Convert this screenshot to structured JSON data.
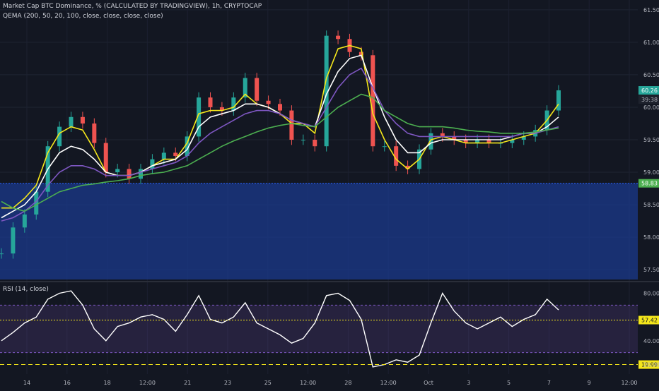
{
  "header": {
    "title": "Market Cap BTC Dominance, % (CALCULATED BY TRADINGVIEW), 1h, CRYPTOCAP",
    "indicator": "QEMA (200, 50, 20, 100, close, close, close, close)"
  },
  "rsi_header": "RSI (14, close)",
  "chart_data": [
    {
      "type": "line",
      "title": "Market Cap BTC Dominance, % (CALCULATED BY TRADINGVIEW), 1h, CRYPTOCAP",
      "ylim": [
        57.35,
        61.65
      ],
      "y_ticks": [
        "57.50",
        "58.00",
        "58.50",
        "59.00",
        "59.50",
        "60.00",
        "60.50",
        "61.00",
        "61.50"
      ],
      "x_ticks": [
        "14",
        "16",
        "18",
        "12:00",
        "21",
        "23",
        "25",
        "12:00",
        "28",
        "12:00",
        "Oct",
        "3",
        "5",
        "7",
        "9",
        "12:00"
      ],
      "x": [
        "13",
        "13.5",
        "14",
        "14.5",
        "15",
        "15.5",
        "16",
        "16.5",
        "17",
        "17.5",
        "18",
        "18.5",
        "19",
        "19.5",
        "20",
        "20.5",
        "21",
        "21.5",
        "22",
        "22.5",
        "23",
        "23.5",
        "24",
        "24.5",
        "25",
        "25.5",
        "26",
        "26.5",
        "27",
        "27.5",
        "28",
        "28.5",
        "29",
        "29.5",
        "30",
        "30.5",
        "Oct",
        "1.5",
        "2",
        "2.5",
        "3",
        "3.5",
        "4",
        "4.5",
        "5",
        "5.5",
        "6",
        "6.5",
        "7"
      ],
      "price": [
        57.75,
        58.15,
        58.35,
        58.7,
        59.4,
        59.7,
        59.85,
        59.75,
        59.45,
        59.0,
        59.05,
        58.9,
        59.05,
        59.2,
        59.3,
        59.25,
        59.55,
        60.15,
        60.0,
        59.95,
        60.15,
        60.45,
        60.1,
        60.05,
        59.95,
        59.5,
        59.5,
        59.4,
        61.1,
        61.05,
        60.85,
        60.8,
        59.4,
        59.4,
        59.1,
        59.05,
        59.35,
        59.6,
        59.55,
        59.5,
        59.45,
        59.5,
        59.45,
        59.45,
        59.5,
        59.55,
        59.65,
        59.95,
        60.26
      ],
      "series": [
        {
          "name": "QEMA 20",
          "color": "#f5e71b",
          "values": [
            58.45,
            58.45,
            58.6,
            58.8,
            59.3,
            59.6,
            59.7,
            59.65,
            59.35,
            59.0,
            58.95,
            58.95,
            59.0,
            59.1,
            59.2,
            59.2,
            59.45,
            59.9,
            59.95,
            59.95,
            60.0,
            60.2,
            60.05,
            60.0,
            59.9,
            59.75,
            59.75,
            59.6,
            60.45,
            60.9,
            60.95,
            60.9,
            59.9,
            59.5,
            59.2,
            59.05,
            59.2,
            59.5,
            59.55,
            59.5,
            59.45,
            59.45,
            59.45,
            59.45,
            59.5,
            59.55,
            59.6,
            59.8,
            60.05
          ]
        },
        {
          "name": "QEMA 50",
          "color": "#ffffff",
          "values": [
            58.3,
            58.4,
            58.5,
            58.7,
            59.05,
            59.3,
            59.4,
            59.35,
            59.2,
            59.0,
            58.95,
            58.95,
            59.0,
            59.1,
            59.15,
            59.2,
            59.35,
            59.7,
            59.85,
            59.9,
            59.95,
            60.05,
            60.05,
            60.0,
            59.9,
            59.8,
            59.75,
            59.7,
            60.2,
            60.55,
            60.75,
            60.8,
            60.3,
            59.85,
            59.5,
            59.3,
            59.3,
            59.45,
            59.5,
            59.5,
            59.5,
            59.5,
            59.5,
            59.5,
            59.55,
            59.6,
            59.6,
            59.7,
            59.85
          ]
        },
        {
          "name": "QEMA 100",
          "color": "#7e57c2",
          "values": [
            58.25,
            58.3,
            58.4,
            58.55,
            58.8,
            59.0,
            59.1,
            59.1,
            59.05,
            58.95,
            58.95,
            58.95,
            59.0,
            59.05,
            59.1,
            59.15,
            59.25,
            59.45,
            59.6,
            59.7,
            59.8,
            59.9,
            59.95,
            59.95,
            59.9,
            59.8,
            59.75,
            59.7,
            60.0,
            60.3,
            60.5,
            60.6,
            60.3,
            59.95,
            59.75,
            59.6,
            59.55,
            59.55,
            59.55,
            59.55,
            59.55,
            59.55,
            59.55,
            59.55,
            59.55,
            59.6,
            59.6,
            59.65,
            59.7
          ]
        },
        {
          "name": "QEMA 200",
          "color": "#4caf50",
          "values": [
            58.55,
            58.45,
            58.4,
            58.5,
            58.6,
            58.7,
            58.75,
            58.8,
            58.82,
            58.85,
            58.87,
            58.9,
            58.95,
            58.98,
            59.0,
            59.05,
            59.1,
            59.2,
            59.3,
            59.4,
            59.48,
            59.55,
            59.62,
            59.68,
            59.72,
            59.75,
            59.72,
            59.7,
            59.85,
            60.0,
            60.1,
            60.2,
            60.15,
            59.95,
            59.85,
            59.75,
            59.7,
            59.7,
            59.7,
            59.68,
            59.65,
            59.63,
            59.62,
            59.6,
            59.6,
            59.6,
            59.62,
            59.65,
            59.68
          ]
        }
      ],
      "last_price": "60.26",
      "countdown": "39:38",
      "level_label": "58.83",
      "level_value": 58.83
    },
    {
      "type": "line",
      "title": "RSI (14, close)",
      "ylim": [
        12,
        88
      ],
      "y_ticks": [
        "20.00",
        "40.00",
        "80.00"
      ],
      "band": [
        30,
        70
      ],
      "series": [
        {
          "name": "RSI",
          "color": "#ffffff",
          "values": [
            40,
            47,
            55,
            60,
            75,
            80,
            82,
            70,
            50,
            40,
            52,
            55,
            60,
            62,
            58,
            48,
            62,
            78,
            58,
            55,
            60,
            72,
            55,
            50,
            45,
            38,
            42,
            55,
            78,
            80,
            74,
            58,
            18,
            20,
            24,
            22,
            28,
            55,
            80,
            65,
            55,
            50,
            55,
            60,
            52,
            58,
            62,
            75,
            66
          ]
        }
      ],
      "current_label": "57.42",
      "current_value": 57.42,
      "level2_label": "19.99",
      "level2_value": 19.99
    }
  ]
}
